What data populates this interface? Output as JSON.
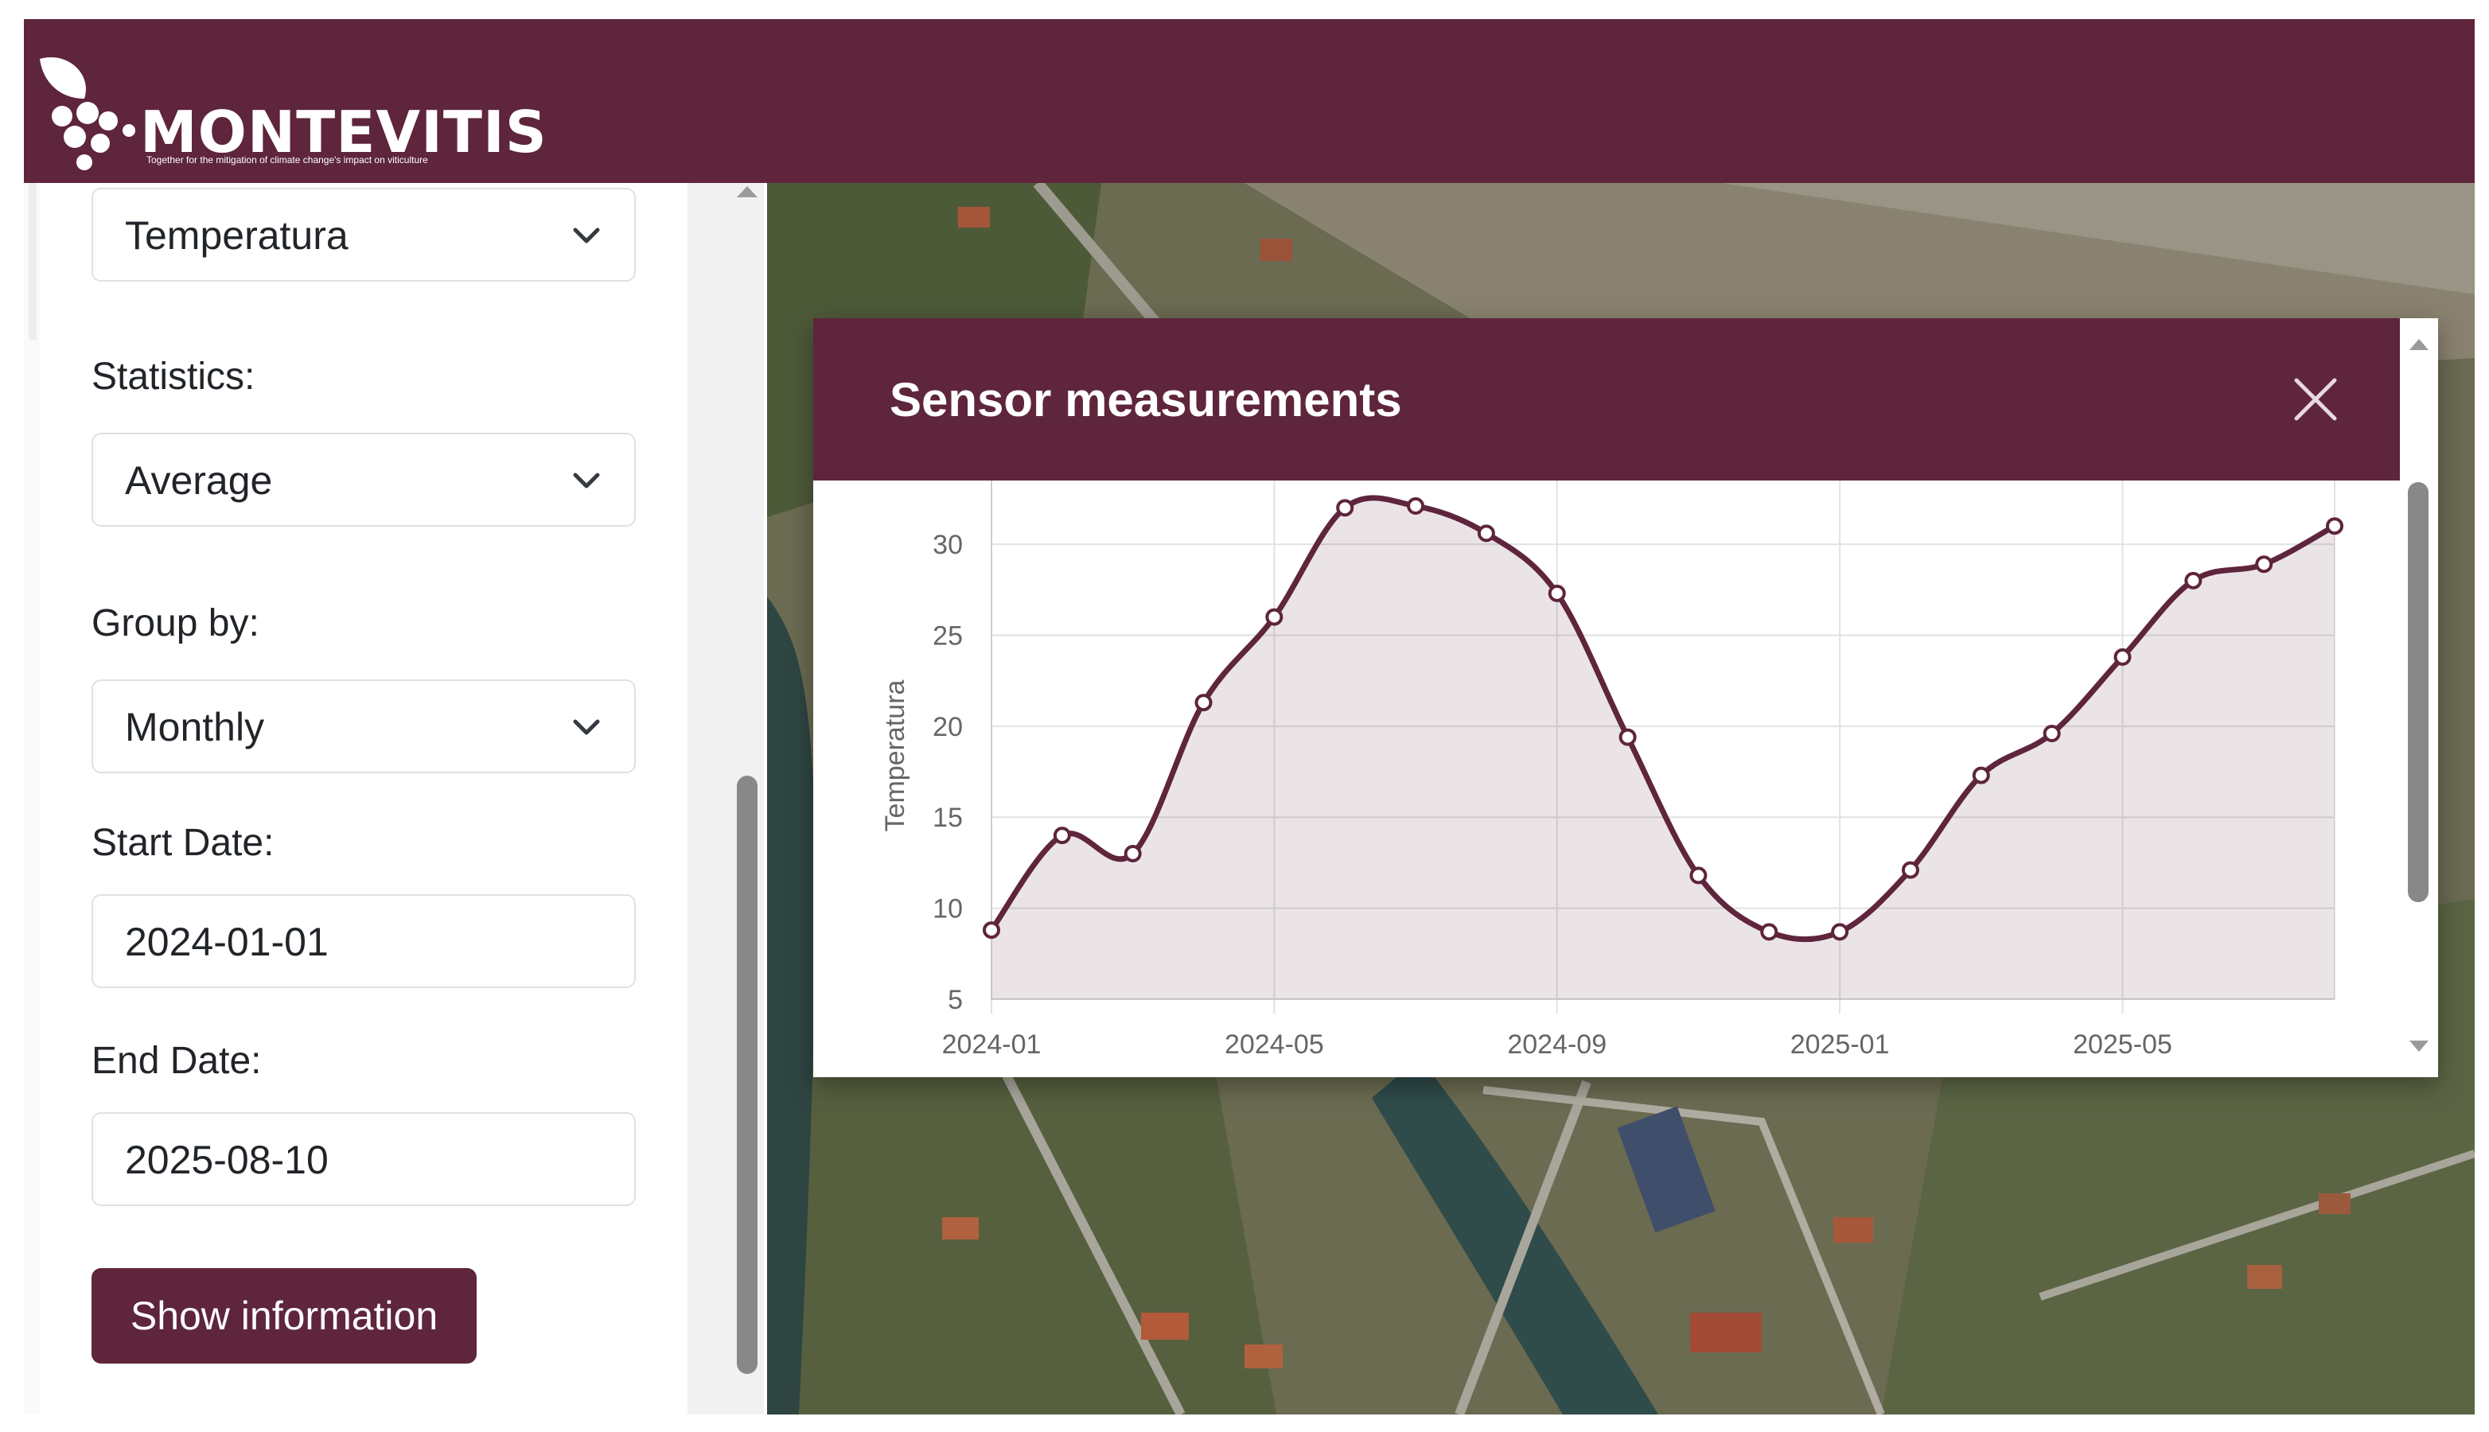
{
  "header": {
    "brand": "MONTEVITIS",
    "tagline": "Together for the mitigation of climate change's impact on viticulture",
    "color": "#5e253c"
  },
  "sidebar": {
    "variable_select": {
      "value": "Temperatura"
    },
    "statistics": {
      "label": "Statistics:",
      "value": "Average"
    },
    "group_by": {
      "label": "Group by:",
      "value": "Monthly"
    },
    "start_date": {
      "label": "Start Date:",
      "value": "2024-01-01"
    },
    "end_date": {
      "label": "End Date:",
      "value": "2025-08-10"
    },
    "show_button": "Show information"
  },
  "modal": {
    "title": "Sensor measurements",
    "close_icon": "close-icon"
  },
  "chart_data": {
    "type": "line",
    "ylabel": "Temperatura",
    "xlabel": "",
    "x": [
      "2024-01",
      "2024-02",
      "2024-03",
      "2024-04",
      "2024-05",
      "2024-06",
      "2024-07",
      "2024-08",
      "2024-09",
      "2024-10",
      "2024-11",
      "2024-12",
      "2025-01",
      "2025-02",
      "2025-03",
      "2025-04",
      "2025-05",
      "2025-06",
      "2025-07",
      "2025-08"
    ],
    "series": [
      {
        "values": [
          8.8,
          14.0,
          13.0,
          21.3,
          26.0,
          32.0,
          32.1,
          30.6,
          27.3,
          19.4,
          11.8,
          8.7,
          8.7,
          12.1,
          17.3,
          19.6,
          23.8,
          28.0,
          28.9,
          31.0
        ],
        "color": "#5e253c",
        "fill": "rgba(94,37,60,0.12)"
      }
    ],
    "xticks": [
      "2024-01",
      "2024-05",
      "2024-09",
      "2025-01",
      "2025-05"
    ],
    "yticks": [
      5,
      10,
      15,
      20,
      25,
      30
    ],
    "ylim": [
      5,
      33.5
    ],
    "grid": true,
    "legend": "none"
  }
}
